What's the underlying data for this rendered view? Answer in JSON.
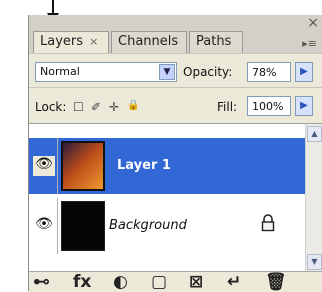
{
  "tabs": [
    {
      "label": "Layers",
      "close": "×"
    },
    {
      "label": "Channels"
    },
    {
      "label": "Paths"
    }
  ],
  "window": {
    "close": "×",
    "menu": "▸≡"
  },
  "controls": {
    "blend_mode": "Normal",
    "opacity_label": "Opacity:",
    "opacity_value": "78%",
    "lock_label": "Lock:",
    "fill_label": "Fill:",
    "fill_value": "100%",
    "stepper_glyph": "▶"
  },
  "layers": [
    {
      "name": "Layer 1",
      "selected": true,
      "thumbnail": "orange-gradient"
    },
    {
      "name": "Background",
      "italic": true,
      "locked": true,
      "thumbnail": "black"
    }
  ],
  "icons": {
    "eye": "👁",
    "dropdown": "▼",
    "lock_transparent": "☐",
    "lock_brush": "✐",
    "lock_move": "✛",
    "lock_all": "🔒",
    "scroll_up": "▲",
    "scroll_down": "▼",
    "bottom": [
      "⊷",
      "fx",
      "◐",
      "▢",
      "⊠",
      "↵",
      "🗑"
    ]
  },
  "colors": {
    "selection": "#3168d5",
    "panel": "#ece9d8"
  }
}
